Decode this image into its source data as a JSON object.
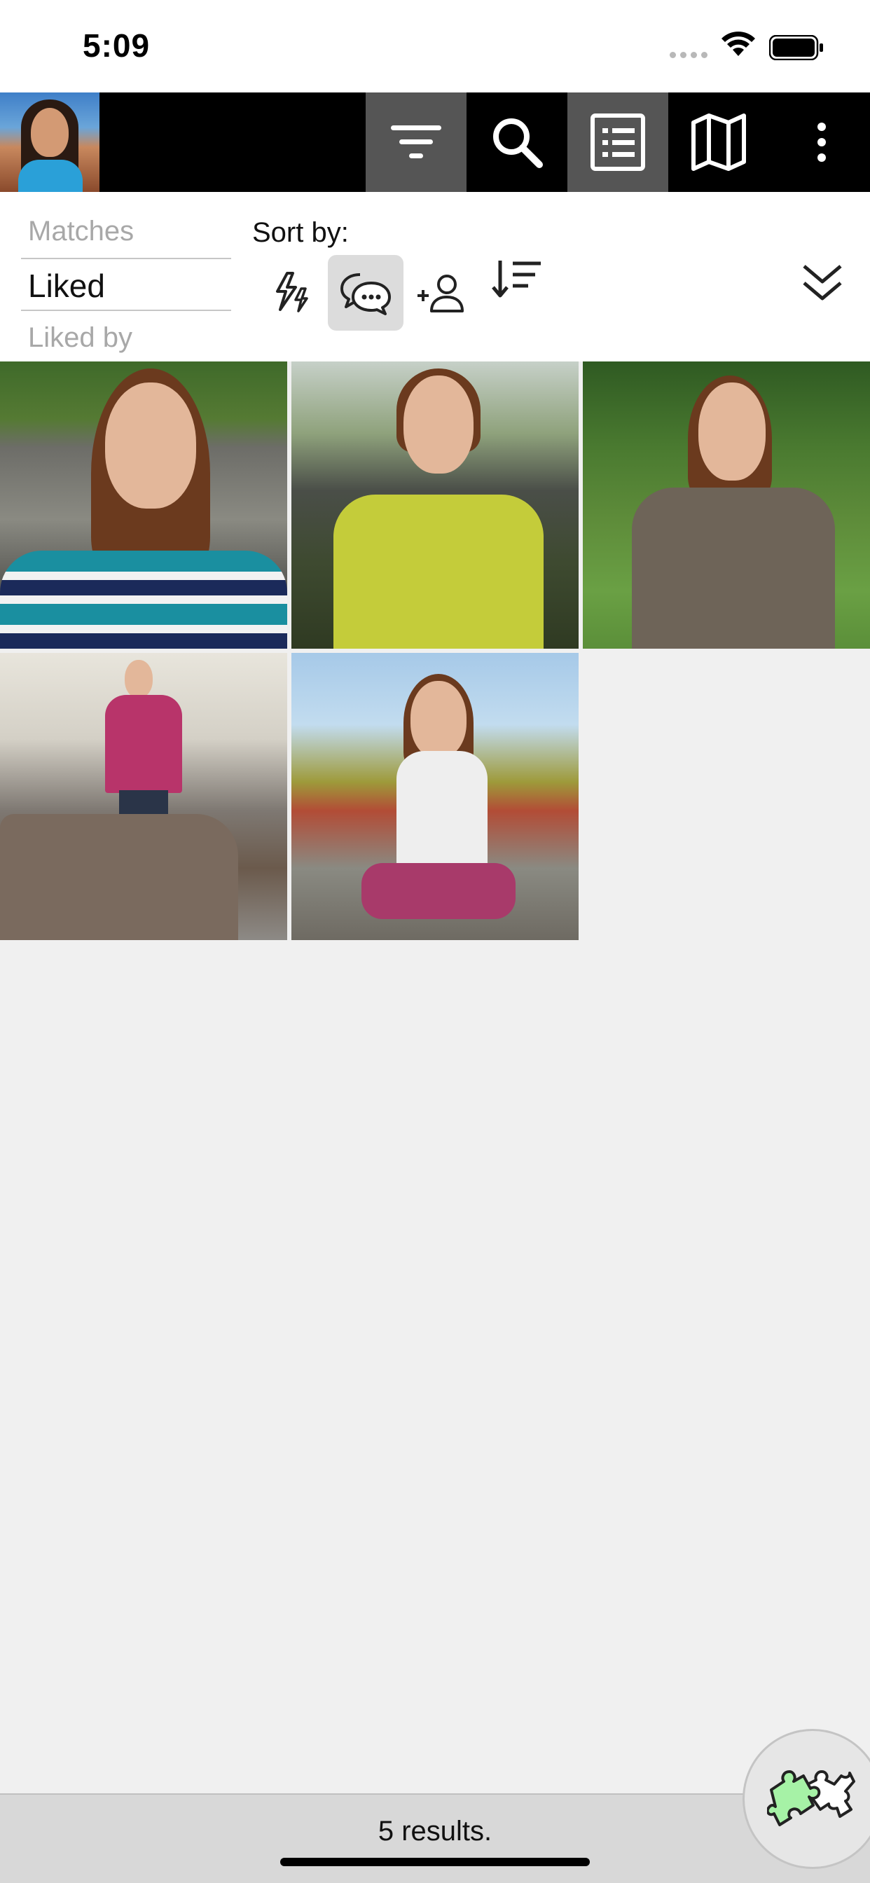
{
  "status_bar": {
    "time": "5:09",
    "icons": [
      "signal-icon",
      "wifi-icon",
      "battery-icon"
    ]
  },
  "toolbar": {
    "avatar": "avatar",
    "buttons": [
      {
        "name": "filter-icon",
        "active": true
      },
      {
        "name": "search-icon",
        "active": false
      },
      {
        "name": "list-view-icon",
        "active": true
      },
      {
        "name": "map-icon",
        "active": false
      },
      {
        "name": "more-vertical-icon",
        "active": false
      }
    ]
  },
  "list_picker": {
    "items": [
      "Matches",
      "Liked",
      "Liked by"
    ],
    "selected": "Liked"
  },
  "sort": {
    "label": "Sort by:",
    "options": [
      {
        "name": "recent-activity-icon",
        "active": false
      },
      {
        "name": "messages-icon",
        "active": true
      },
      {
        "name": "newest-icon",
        "active": false
      },
      {
        "name": "sort-order-icon",
        "active": false
      }
    ]
  },
  "collapse_icon": "chevron-double-down-icon",
  "photos": [
    {
      "index": 1,
      "shirt_color": "#1a8fa0"
    },
    {
      "index": 2,
      "shirt_color": "#c4cc3a"
    },
    {
      "index": 3,
      "shirt_color": "#6e6458"
    },
    {
      "index": 4,
      "shirt_color": "#b8346a"
    },
    {
      "index": 5,
      "shirt_color": "#eeeeee"
    }
  ],
  "footer": {
    "results": "5 results."
  },
  "fab_icon": "puzzle-icon",
  "colors": {
    "toolbar_bg": "#000000",
    "active_button": "#555555",
    "sort_active": "#dcdcdc",
    "page_bg": "#f0f0f0",
    "fab_accent": "#a6f2a6"
  }
}
